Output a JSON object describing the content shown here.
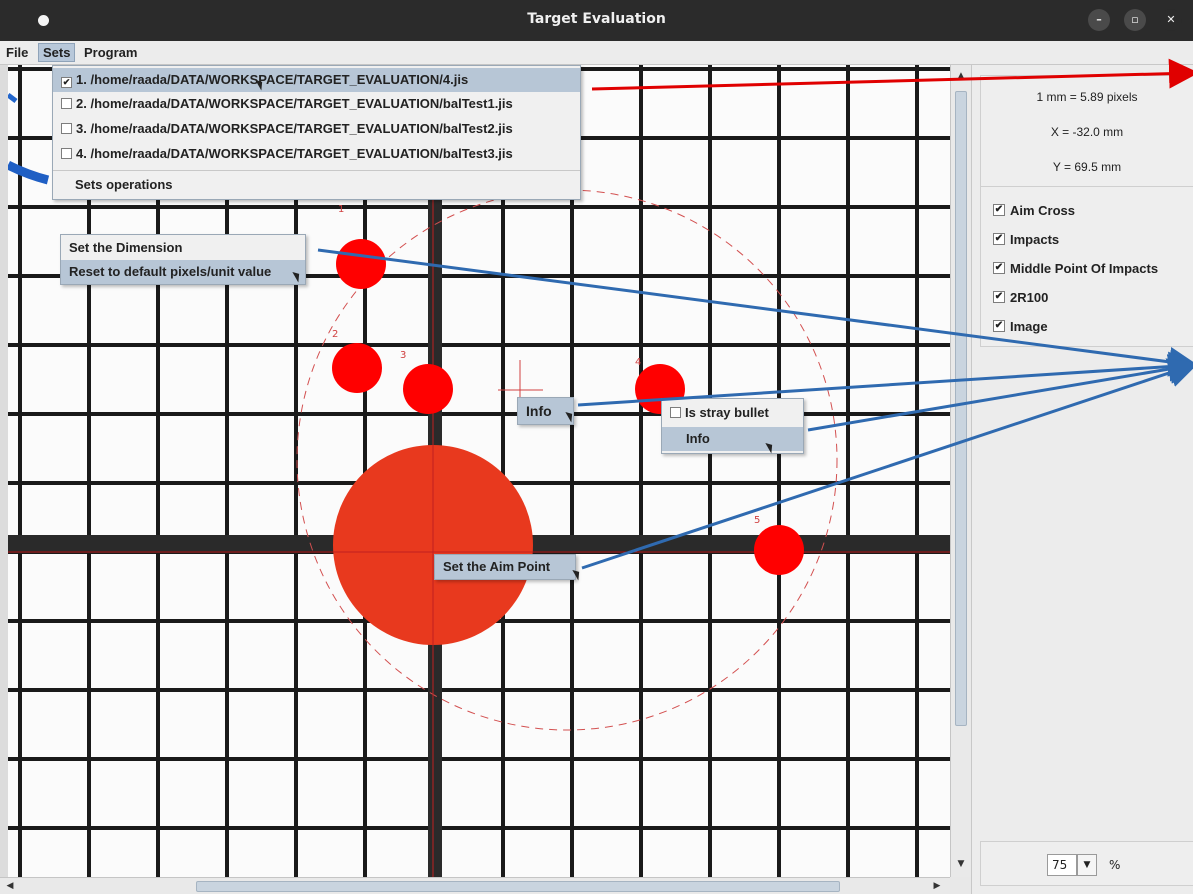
{
  "window": {
    "title": "Target Evaluation",
    "controls": [
      "minimize-icon",
      "maximize-icon",
      "close-icon"
    ]
  },
  "menubar": {
    "file": "File",
    "sets": "Sets",
    "program": "Program"
  },
  "sets_menu": {
    "items": [
      {
        "label": "1. /home/raada/DATA/WORKSPACE/TARGET_EVALUATION/4.jis",
        "checked": true
      },
      {
        "label": "2. /home/raada/DATA/WORKSPACE/TARGET_EVALUATION/balTest1.jis",
        "checked": false
      },
      {
        "label": "3. /home/raada/DATA/WORKSPACE/TARGET_EVALUATION/balTest2.jis",
        "checked": false
      },
      {
        "label": "4. /home/raada/DATA/WORKSPACE/TARGET_EVALUATION/balTest3.jis",
        "checked": false
      }
    ],
    "operations": "Sets operations"
  },
  "dimension_menu": {
    "set_dimension": "Set the Dimension",
    "reset_default": "Reset to default pixels/unit value"
  },
  "mpi_menu": {
    "info": "Info"
  },
  "impact_menu": {
    "stray": "Is stray bullet",
    "stray_checked": false,
    "info": "Info"
  },
  "aim_menu": {
    "set_aim_point": "Set the Aim Point"
  },
  "impact_numbers": [
    "1",
    "2",
    "3",
    "4",
    "5"
  ],
  "panel": {
    "scale": "1 mm = 5.89 pixels",
    "x": "X = -32.0 mm",
    "y": "Y = 69.5 mm",
    "checks": [
      {
        "label": "Aim Cross",
        "checked": true
      },
      {
        "label": "Impacts",
        "checked": true
      },
      {
        "label": "Middle Point Of Impacts",
        "checked": true
      },
      {
        "label": "2R100",
        "checked": true
      },
      {
        "label": "Image",
        "checked": true
      }
    ],
    "zoom": "75",
    "zoom_unit": "%"
  },
  "colors": {
    "impact": "#ff0000",
    "aim_disc": "#e8391e",
    "annotation_red": "#e00000",
    "annotation_blue": "#2f6ab0",
    "grid_line": "#1a1a1a"
  }
}
